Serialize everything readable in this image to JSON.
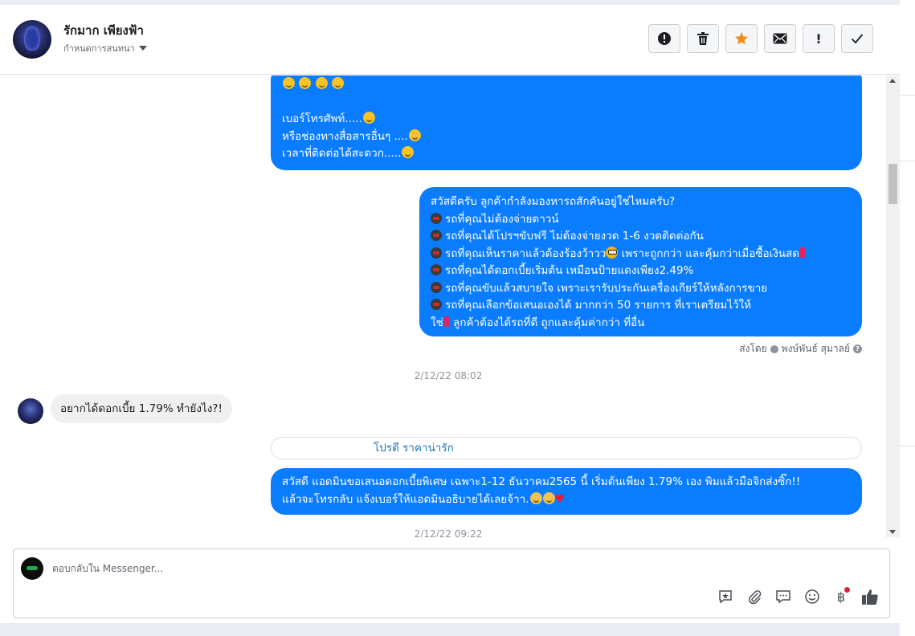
{
  "header": {
    "contact_name": "รักมาก เพียงฟ้า",
    "assign_label": "กำหนดการสนทนา",
    "toolbar": [
      {
        "name": "report-spam-button",
        "icon": "alert-circle-icon"
      },
      {
        "name": "delete-button",
        "icon": "trash-icon"
      },
      {
        "name": "star-button",
        "icon": "star-icon"
      },
      {
        "name": "mark-unread-button",
        "icon": "envelope-icon"
      },
      {
        "name": "follow-up-button",
        "icon": "exclamation-icon",
        "text": "!"
      },
      {
        "name": "mark-done-button",
        "icon": "check-icon"
      }
    ]
  },
  "messages": {
    "msg1_lines": [
      "เบอร์โทรศัพท์.....",
      "หรือช่องทางสื่อสารอื่นๆ ....",
      "เวลาที่ติดต่อได้สะดวก....."
    ],
    "msg2_lines": [
      "สวัสดีครับ ลูกค้ากำลังมองหารถสักคันอยู่ใช่ไหมครับ?",
      "รถที่คุณไม่ต้องจ่ายดาวน์",
      "รถที่คุณได้โปรฯขับฟรี ไม่ต้องจ่ายงวด 1-6 งวดติดต่อกัน",
      "รถที่คุณเห็นราคาแล้วต้องร้องว้าวว",
      " เพราะถูกกว่า และคุ้มกว่าเมื่อซื้อเงินสด",
      "รถที่คุณได้ดอกเบี้ยเริ่มต้น เหมือนป้ายแดงเพียง2.49%",
      "รถที่คุณขับแล้วสบายใจ เพราะเรารับประกันเครื่องเกียร์ให้หลังการขาย",
      "รถที่คุณเลือกข้อเสนอเองได้ มากกว่า 50 รายการ ที่เราเตรียมไว้ให้",
      "ใช่",
      " ลูกค้าต้องได้รถที่ดี ถูกและคุ้มค่ากว่า ที่อื่น"
    ],
    "sent_by_label": "ส่งโดย",
    "sent_by_name": "พงษ์พันธ์ สุมาลย์",
    "timestamp1": "2/12/22 08:02",
    "incoming_text": "อยากได้ดอกเบี้ย 1.79% ทำยังไง?!",
    "link_card_text": "โปรดี ราคาน่ารัก",
    "msg3_line1": "สวัสดี แอดมินขอเสนอดอกเบี้ยพิเศษ เฉพาะ1-12 ธันวาคม2565 นี้ เริ่มต้นเพียง 1.79% เอง พิมแล้วมือจิกส่งซิ๊ก!!",
    "msg3_line2": "แล้วจะโทรกลับ แจ้งเบอร์ให้แอดมินอธิบายได้เลยจ้าา.",
    "timestamp2": "2/12/22 09:22"
  },
  "composer": {
    "placeholder": "ตอบกลับใน Messenger...",
    "baht_symbol": "฿"
  },
  "colors": {
    "outgoing_bubble": "#0a7cff",
    "incoming_bubble": "#f0f0f0",
    "link": "#1876b6",
    "star": "#f28b1c"
  }
}
